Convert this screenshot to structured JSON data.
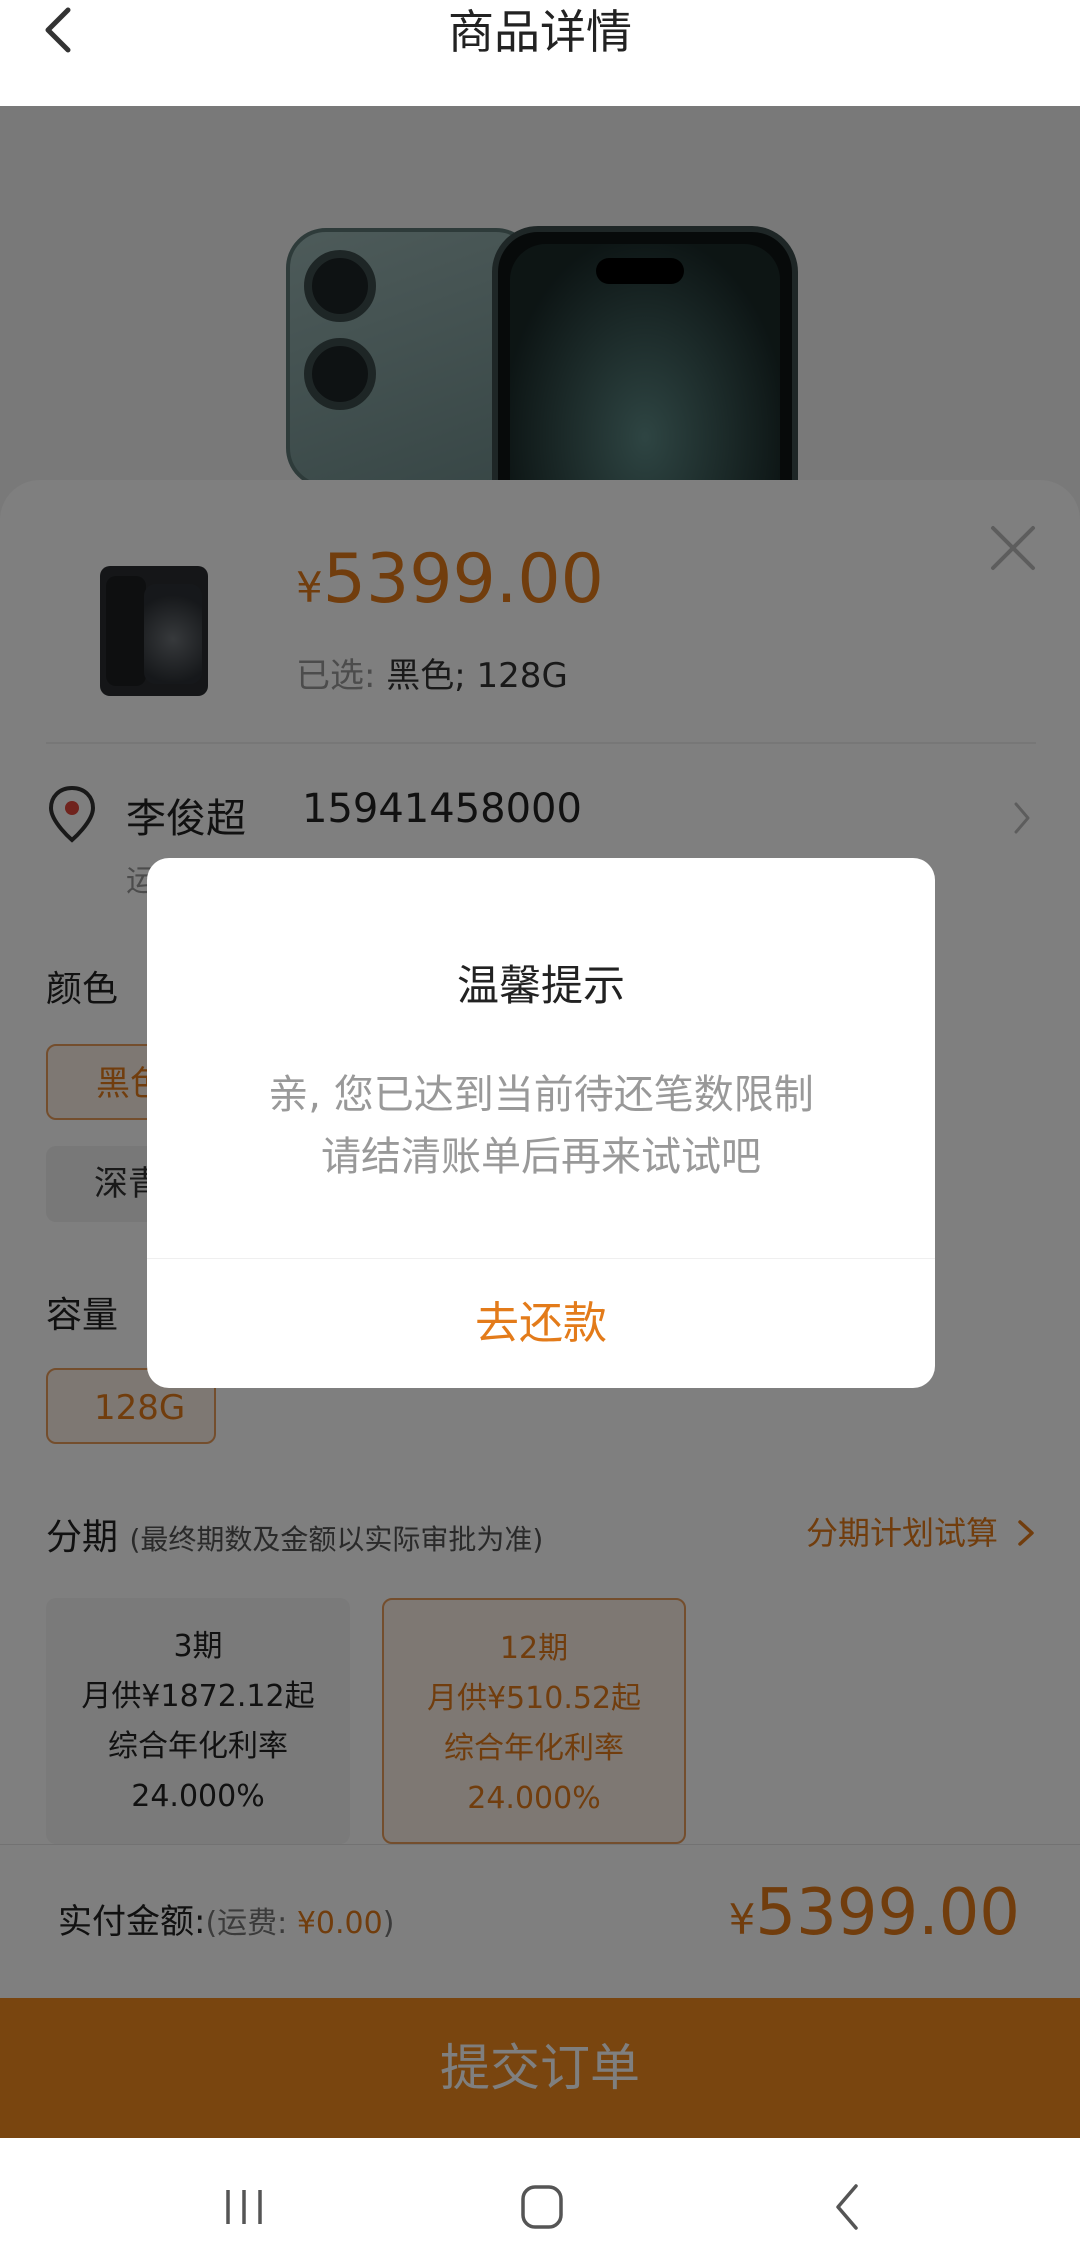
{
  "header": {
    "title": "商品详情"
  },
  "product": {
    "price_currency": "¥",
    "price_value": "5399.00",
    "selected_label": "已选:",
    "selected_value": "黑色; 128G"
  },
  "address": {
    "name": "李俊超",
    "phone": "15941458000",
    "line_fragment": "运"
  },
  "color": {
    "label": "颜色",
    "options": [
      {
        "label": "黑色",
        "selected": true
      },
      {
        "label": "深青色",
        "selected": false
      }
    ]
  },
  "capacity": {
    "label": "容量",
    "options": [
      {
        "label": "128G",
        "selected": true
      }
    ]
  },
  "installment": {
    "title": "分期",
    "note": "(最终期数及金额以实际审批为准)",
    "calc_link": "分期计划试算",
    "plans": [
      {
        "term": "3期",
        "monthly": "月供¥1872.12起",
        "rate_label": "综合年化利率",
        "rate": "24.000%",
        "selected": false
      },
      {
        "term": "12期",
        "monthly": "月供¥510.52起",
        "rate_label": "综合年化利率",
        "rate": "24.000%",
        "selected": true
      }
    ]
  },
  "payment": {
    "label": "实付金额:",
    "shipping_prefix": "(运费: ",
    "shipping_value": "¥0.00",
    "shipping_suffix": ")",
    "total_currency": "¥",
    "total_value": "5399.00"
  },
  "submit_label": "提交订单",
  "dialog": {
    "title": "温馨提示",
    "message_line1": "亲, 您已达到当前待还笔数限制",
    "message_line2": "请结清账单后再来试试吧",
    "button": "去还款"
  },
  "icons": {
    "back": "chevron-left-icon",
    "close": "close-icon",
    "location": "location-pin-icon",
    "chevron": "chevron-right-icon",
    "nav_recents": "recent-apps-icon",
    "nav_home": "home-icon",
    "nav_back": "back-icon"
  },
  "colors": {
    "accent": "#e37b1a",
    "submit_bg": "#f28b1e",
    "overlay": "rgba(0,0,0,0.5)"
  }
}
